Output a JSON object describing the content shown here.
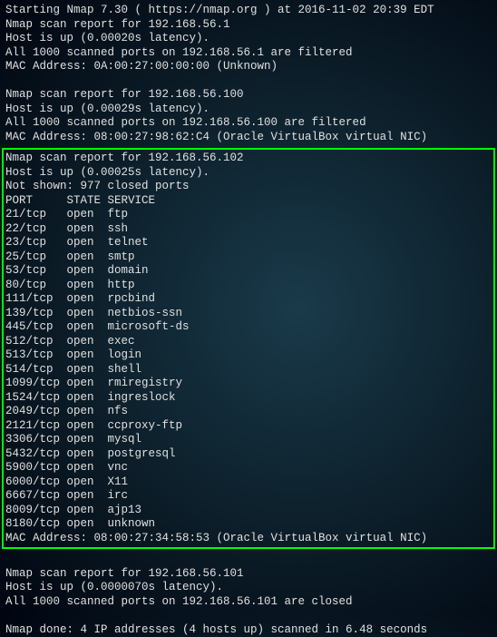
{
  "header": "Starting Nmap 7.30 ( https://nmap.org ) at 2016-11-02 20:39 EDT",
  "host1": {
    "report": "Nmap scan report for 192.168.56.1",
    "status": "Host is up (0.00020s latency).",
    "ports": "All 1000 scanned ports on 192.168.56.1 are filtered",
    "mac": "MAC Address: 0A:00:27:00:00:00 (Unknown)"
  },
  "host2": {
    "report": "Nmap scan report for 192.168.56.100",
    "status": "Host is up (0.00029s latency).",
    "ports": "All 1000 scanned ports on 192.168.56.100 are filtered",
    "mac": "MAC Address: 08:00:27:98:62:C4 (Oracle VirtualBox virtual NIC)"
  },
  "host3": {
    "report": "Nmap scan report for 192.168.56.102",
    "status": "Host is up (0.00025s latency).",
    "notshown": "Not shown: 977 closed ports",
    "tableheader": "PORT     STATE SERVICE",
    "ports": [
      "21/tcp   open  ftp",
      "22/tcp   open  ssh",
      "23/tcp   open  telnet",
      "25/tcp   open  smtp",
      "53/tcp   open  domain",
      "80/tcp   open  http",
      "111/tcp  open  rpcbind",
      "139/tcp  open  netbios-ssn",
      "445/tcp  open  microsoft-ds",
      "512/tcp  open  exec",
      "513/tcp  open  login",
      "514/tcp  open  shell",
      "1099/tcp open  rmiregistry",
      "1524/tcp open  ingreslock",
      "2049/tcp open  nfs",
      "2121/tcp open  ccproxy-ftp",
      "3306/tcp open  mysql",
      "5432/tcp open  postgresql",
      "5900/tcp open  vnc",
      "6000/tcp open  X11",
      "6667/tcp open  irc",
      "8009/tcp open  ajp13",
      "8180/tcp open  unknown"
    ],
    "mac": "MAC Address: 08:00:27:34:58:53 (Oracle VirtualBox virtual NIC)"
  },
  "host4": {
    "report": "Nmap scan report for 192.168.56.101",
    "status": "Host is up (0.0000070s latency).",
    "ports": "All 1000 scanned ports on 192.168.56.101 are closed"
  },
  "footer": "Nmap done: 4 IP addresses (4 hosts up) scanned in 6.48 seconds"
}
